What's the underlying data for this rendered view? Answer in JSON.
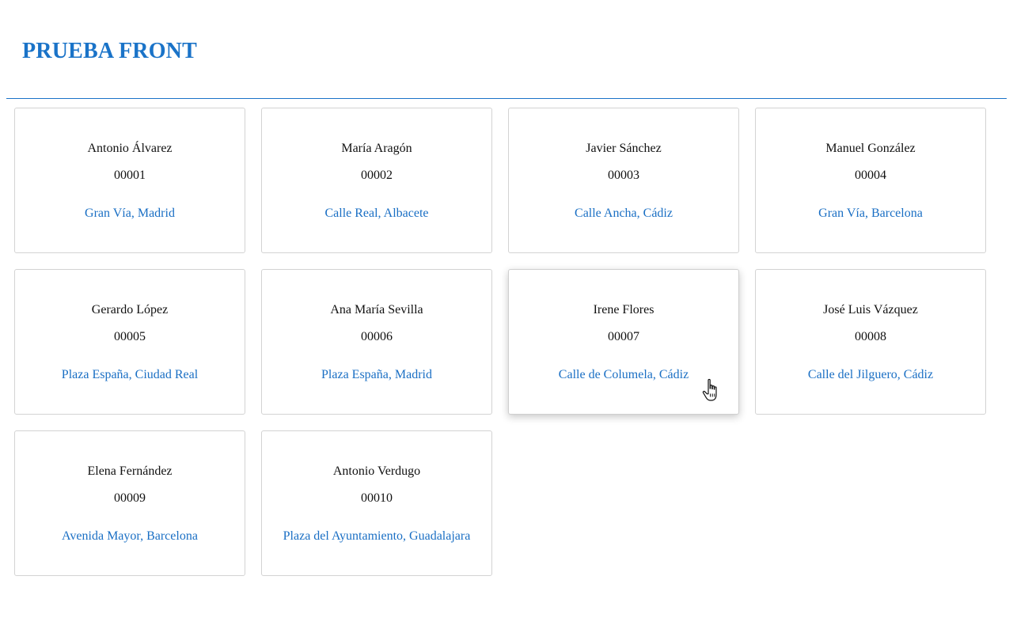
{
  "header": {
    "title": "PRUEBA FRONT",
    "accent_color": "#1a73c8"
  },
  "cards": [
    {
      "name": "Antonio Álvarez",
      "id": "00001",
      "address": "Gran Vía, Madrid"
    },
    {
      "name": "María Aragón",
      "id": "00002",
      "address": "Calle Real, Albacete"
    },
    {
      "name": "Javier Sánchez",
      "id": "00003",
      "address": "Calle Ancha, Cádiz"
    },
    {
      "name": "Manuel González",
      "id": "00004",
      "address": "Gran Vía, Barcelona"
    },
    {
      "name": "Gerardo López",
      "id": "00005",
      "address": "Plaza España, Ciudad Real"
    },
    {
      "name": "Ana María Sevilla",
      "id": "00006",
      "address": "Plaza España, Madrid"
    },
    {
      "name": "Irene Flores",
      "id": "00007",
      "address": "Calle de Columela, Cádiz"
    },
    {
      "name": "José Luis Vázquez",
      "id": "00008",
      "address": "Calle del Jilguero, Cádiz"
    },
    {
      "name": "Elena Fernández",
      "id": "00009",
      "address": "Avenida Mayor, Barcelona"
    },
    {
      "name": "Antonio Verdugo",
      "id": "00010",
      "address": "Plaza del Ayuntamiento, Guadalajara"
    }
  ],
  "hovered_card": "00007",
  "cursor": {
    "icon": "hand-pointer-icon"
  }
}
